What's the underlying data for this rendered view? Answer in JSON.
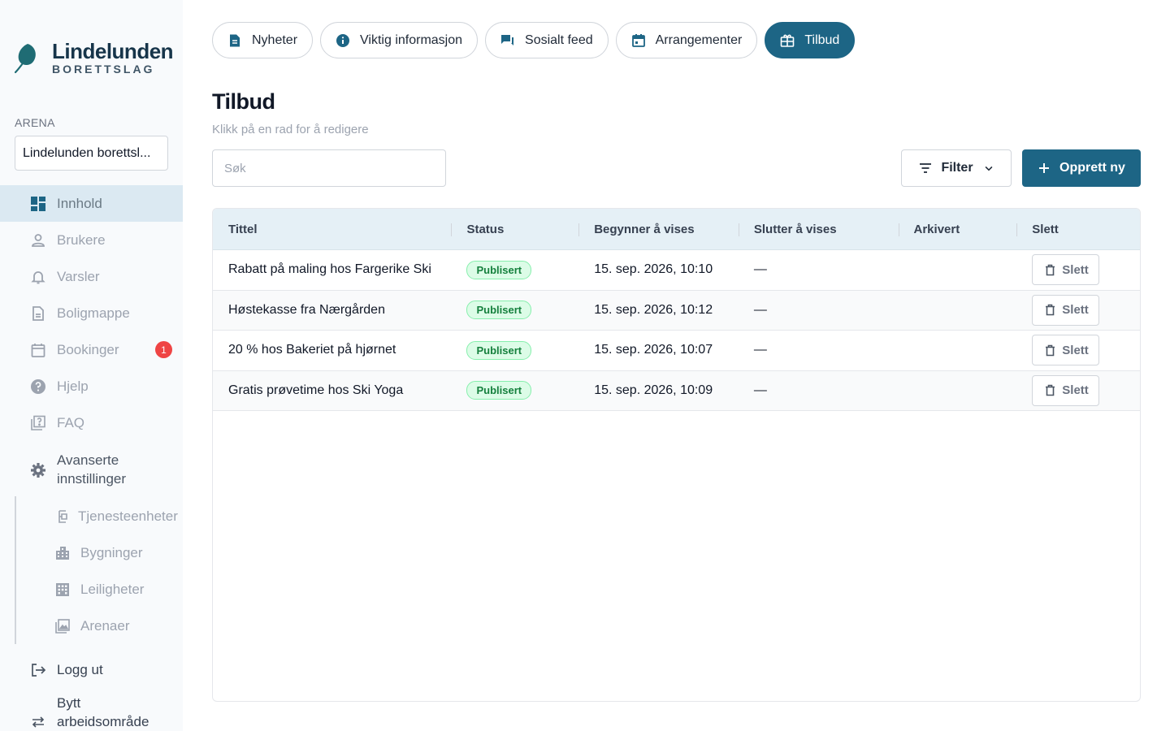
{
  "brand": {
    "name": "Lindelunden",
    "subtitle": "BORETTSLAG"
  },
  "sidebar": {
    "arena_label": "ARENA",
    "arena_value": "Lindelunden borettsl...",
    "items": [
      {
        "label": "Innhold"
      },
      {
        "label": "Brukere"
      },
      {
        "label": "Varsler"
      },
      {
        "label": "Boligmappe"
      },
      {
        "label": "Bookinger",
        "badge": "1"
      },
      {
        "label": "Hjelp"
      },
      {
        "label": "FAQ"
      },
      {
        "label_line1": "Avanserte",
        "label_line2": "innstillinger"
      }
    ],
    "sub_items": [
      {
        "label": "Tjenesteenheter"
      },
      {
        "label": "Bygninger"
      },
      {
        "label": "Leiligheter"
      },
      {
        "label": "Arenaer"
      }
    ],
    "logout": "Logg ut",
    "switch_line1": "Bytt",
    "switch_line2": "arbeidsområde"
  },
  "tabs": [
    {
      "label": "Nyheter",
      "icon": "article-icon"
    },
    {
      "label": "Viktig informasjon",
      "icon": "info-icon"
    },
    {
      "label": "Sosialt feed",
      "icon": "chat-icon"
    },
    {
      "label": "Arrangementer",
      "icon": "calendar-icon"
    },
    {
      "label": "Tilbud",
      "icon": "gift-icon",
      "active": true
    }
  ],
  "page": {
    "title": "Tilbud",
    "subtitle": "Klikk på en rad for å redigere",
    "search_placeholder": "Søk",
    "filter_label": "Filter",
    "create_label": "Opprett ny"
  },
  "table": {
    "columns": [
      "Tittel",
      "Status",
      "Begynner å vises",
      "Slutter å vises",
      "Arkivert",
      "Slett"
    ],
    "rows": [
      {
        "title": "Rabatt på maling hos Fargerike Ski",
        "status": "Publisert",
        "start": "15. sep. 2026, 10:10",
        "end": "—",
        "archived": "",
        "delete": "Slett"
      },
      {
        "title": "Høstekasse fra Nærgården",
        "status": "Publisert",
        "start": "15. sep. 2026, 10:12",
        "end": "—",
        "archived": "",
        "delete": "Slett"
      },
      {
        "title": "20 % hos Bakeriet på hjørnet",
        "status": "Publisert",
        "start": "15. sep. 2026, 10:07",
        "end": "—",
        "archived": "",
        "delete": "Slett"
      },
      {
        "title": "Gratis prøvetime hos Ski Yoga",
        "status": "Publisert",
        "start": "15. sep. 2026, 10:09",
        "end": "—",
        "archived": "",
        "delete": "Slett"
      }
    ]
  },
  "colors": {
    "accent": "#1d6585",
    "badge": "#ef4444",
    "status_published": "#15803d"
  }
}
